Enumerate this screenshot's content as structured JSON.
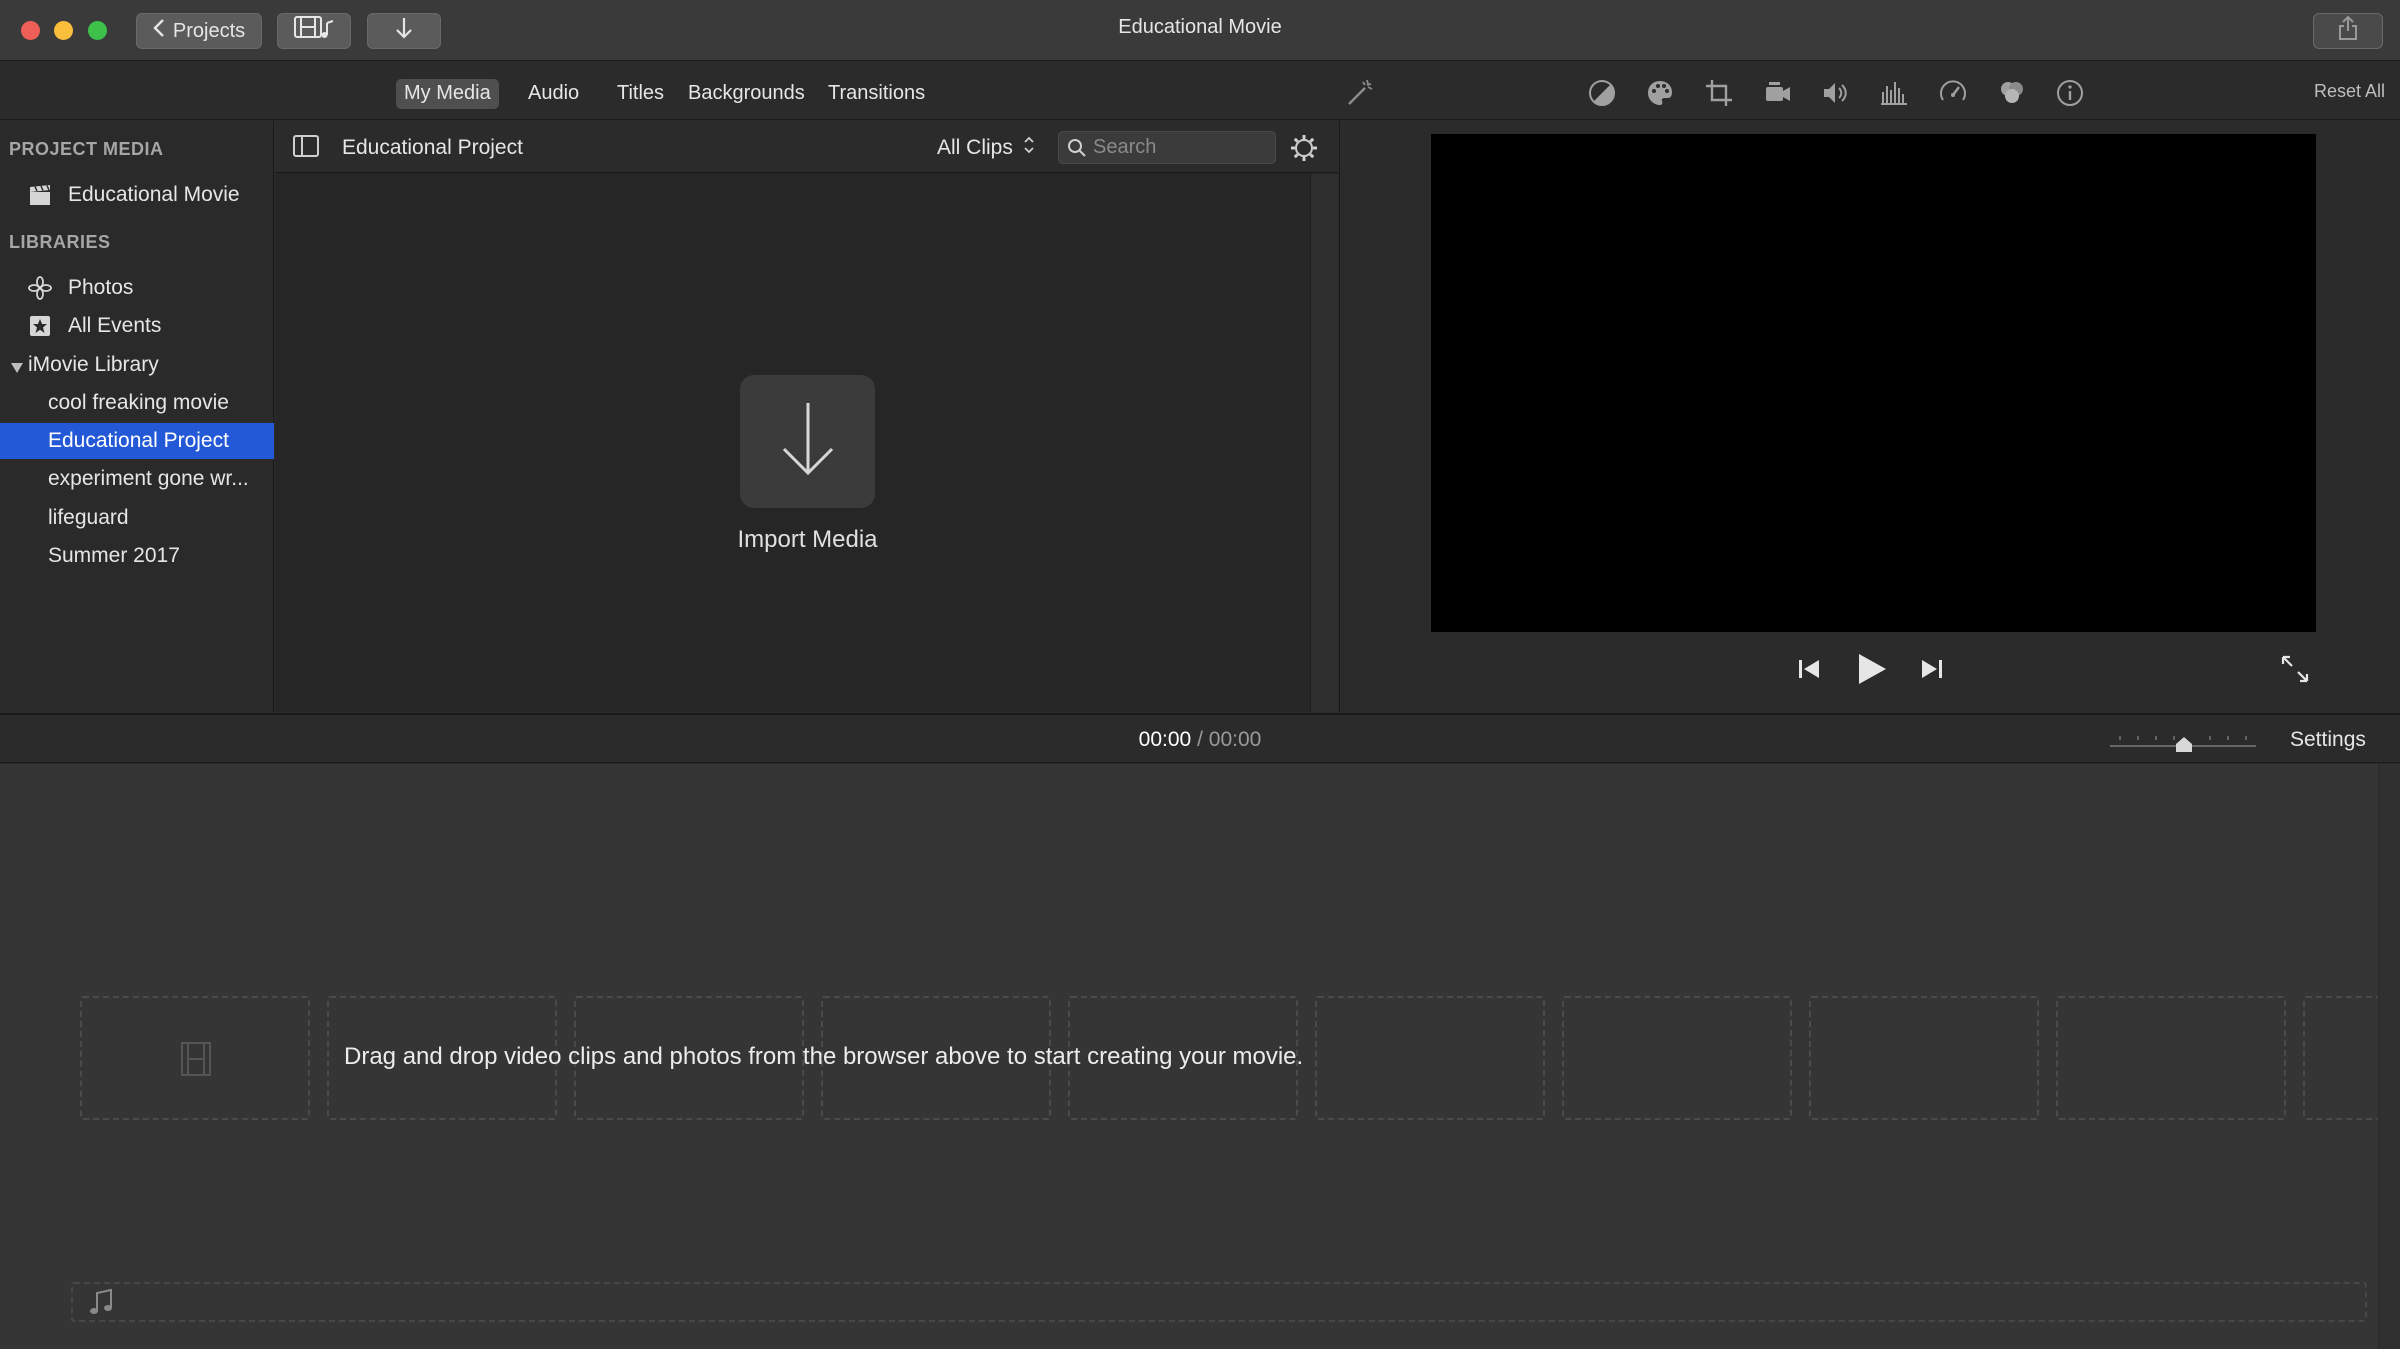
{
  "titlebar": {
    "projects_label": "Projects",
    "window_title": "Educational Movie"
  },
  "browser_tabs": [
    {
      "label": "My Media",
      "active": true
    },
    {
      "label": "Audio",
      "active": false
    },
    {
      "label": "Titles",
      "active": false
    },
    {
      "label": "Backgrounds",
      "active": false
    },
    {
      "label": "Transitions",
      "active": false
    }
  ],
  "adjust_bar": {
    "icons": [
      "magic-wand-icon",
      "color-balance-icon",
      "color-palette-icon",
      "crop-icon",
      "stabilization-icon",
      "volume-icon",
      "equalizer-icon",
      "speed-icon",
      "clip-filter-icon",
      "info-icon"
    ],
    "reset_label": "Reset All"
  },
  "sidebar": {
    "project_media_heading": "PROJECT MEDIA",
    "project_item": "Educational Movie",
    "libraries_heading": "LIBRARIES",
    "photos": "Photos",
    "all_events": "All Events",
    "library_name": "iMovie Library",
    "events": [
      {
        "label": "cool freaking movie",
        "selected": false
      },
      {
        "label": "Educational Project",
        "selected": true
      },
      {
        "label": "experiment gone wr...",
        "selected": false
      },
      {
        "label": "lifeguard",
        "selected": false
      },
      {
        "label": "Summer 2017",
        "selected": false
      }
    ]
  },
  "browser": {
    "title": "Educational Project",
    "filter": "All Clips",
    "search_placeholder": "Search",
    "import_label": "Import Media"
  },
  "timeline": {
    "current_time": "00:00",
    "separator": "/",
    "total_time": "00:00",
    "settings_label": "Settings",
    "drop_hint": "Drag and drop video clips and photos from the browser above to start creating your movie."
  },
  "colors": {
    "selection": "#2358d6",
    "close": "#ee5f58",
    "minimize": "#f8be3c",
    "maximize": "#3dc14a"
  }
}
